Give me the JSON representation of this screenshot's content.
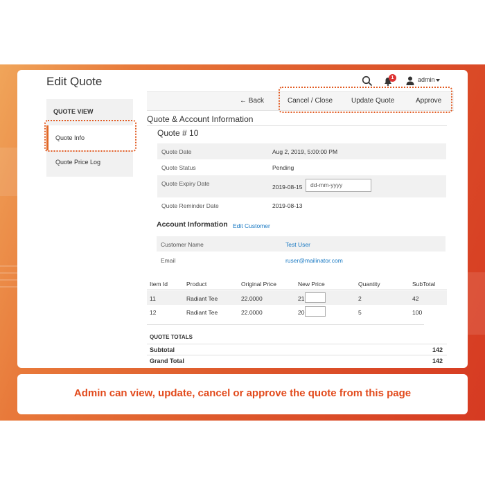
{
  "header": {
    "page_title": "Edit Quote",
    "notification_count": "1",
    "user_name": "admin"
  },
  "sidebar": {
    "heading": "QUOTE VIEW",
    "items": [
      {
        "label": "Quote Info",
        "active": true
      },
      {
        "label": "Quote Price Log",
        "active": false
      }
    ]
  },
  "actions": {
    "back_label": "← Back",
    "cancel_label": "Cancel / Close",
    "update_label": "Update Quote",
    "approve_label": "Approve"
  },
  "quote_info": {
    "section_title": "Quote & Account Information",
    "quote_number": "Quote # 10",
    "rows": [
      {
        "label": "Quote Date",
        "value": "Aug 2, 2019, 5:00:00 PM"
      },
      {
        "label": "Quote Status",
        "value": "Pending"
      },
      {
        "label": "Quote Expiry Date",
        "value": "2019-08-15",
        "input_placeholder": "dd-mm-yyyy"
      },
      {
        "label": "Quote Reminder Date",
        "value": "2019-08-13"
      }
    ]
  },
  "account": {
    "title": "Account Information",
    "edit_link": "Edit Customer",
    "rows": [
      {
        "label": "Customer Name",
        "value": "Test User"
      },
      {
        "label": "Email",
        "value": "ruser@mailinator.com"
      }
    ]
  },
  "items": {
    "headers": [
      "Item Id",
      "Product",
      "Original Price",
      "New Price",
      "Quantity",
      "SubTotal"
    ],
    "rows": [
      {
        "id": "11",
        "product": "Radiant Tee",
        "original_price": "22.0000",
        "new_price": "21",
        "quantity": "2",
        "subtotal": "42"
      },
      {
        "id": "12",
        "product": "Radiant Tee",
        "original_price": "22.0000",
        "new_price": "20",
        "quantity": "5",
        "subtotal": "100"
      }
    ]
  },
  "totals": {
    "heading": "QUOTE TOTALS",
    "subtotal_label": "Subtotal",
    "subtotal_value": "142",
    "grand_total_label": "Grand Total",
    "grand_total_value": "142"
  },
  "caption": "Admin can view, update, cancel or approve the quote from this page",
  "colors": {
    "accent": "#e25b22",
    "link": "#1979c3"
  }
}
